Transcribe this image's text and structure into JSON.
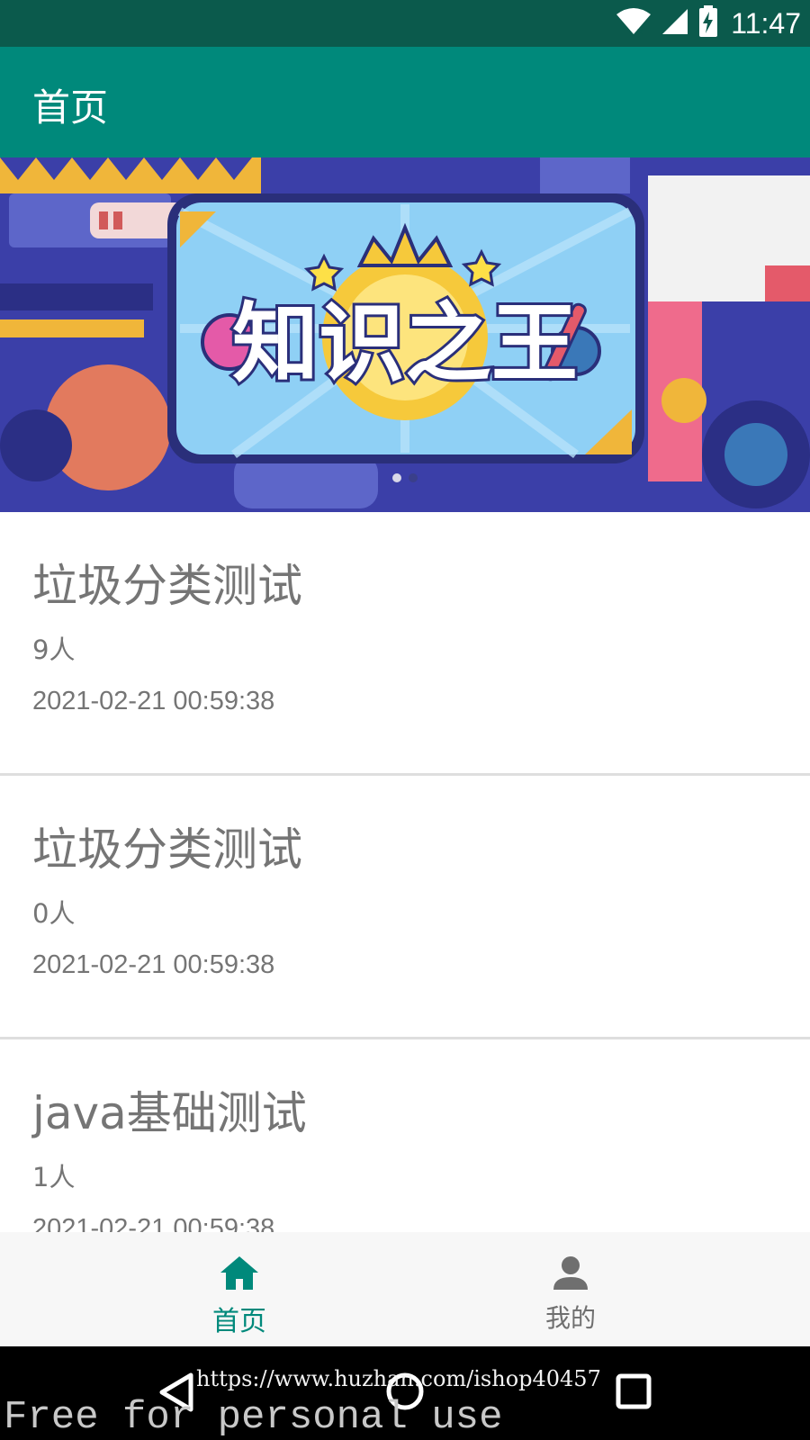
{
  "status_bar": {
    "time": "11:47",
    "icons": [
      "wifi-icon",
      "signal-icon",
      "battery-charging-icon"
    ]
  },
  "app_bar": {
    "title": "首页"
  },
  "banner": {
    "title": "知识之王",
    "page_count": 2,
    "active_page": 1
  },
  "list": {
    "items": [
      {
        "title": "垃圾分类测试",
        "count": "9人",
        "time": "2021-02-21 00:59:38"
      },
      {
        "title": "垃圾分类测试",
        "count": "0人",
        "time": "2021-02-21 00:59:38"
      },
      {
        "title": "java基础测试",
        "count": "1人",
        "time": "2021-02-21 00:59:38"
      }
    ]
  },
  "bottom_nav": {
    "items": [
      {
        "label": "首页",
        "icon": "home-icon",
        "active": true
      },
      {
        "label": "我的",
        "icon": "person-icon",
        "active": false
      }
    ]
  },
  "system_nav": {
    "buttons": [
      "back-icon",
      "home-circle-icon",
      "recents-icon"
    ]
  },
  "overlay": {
    "url": "https://www.huzhan.com/ishop40457",
    "watermark": "Free for personal use"
  },
  "colors": {
    "primary": "#00897b",
    "status_bar": "#0b5a4c",
    "text_secondary": "#757575"
  }
}
